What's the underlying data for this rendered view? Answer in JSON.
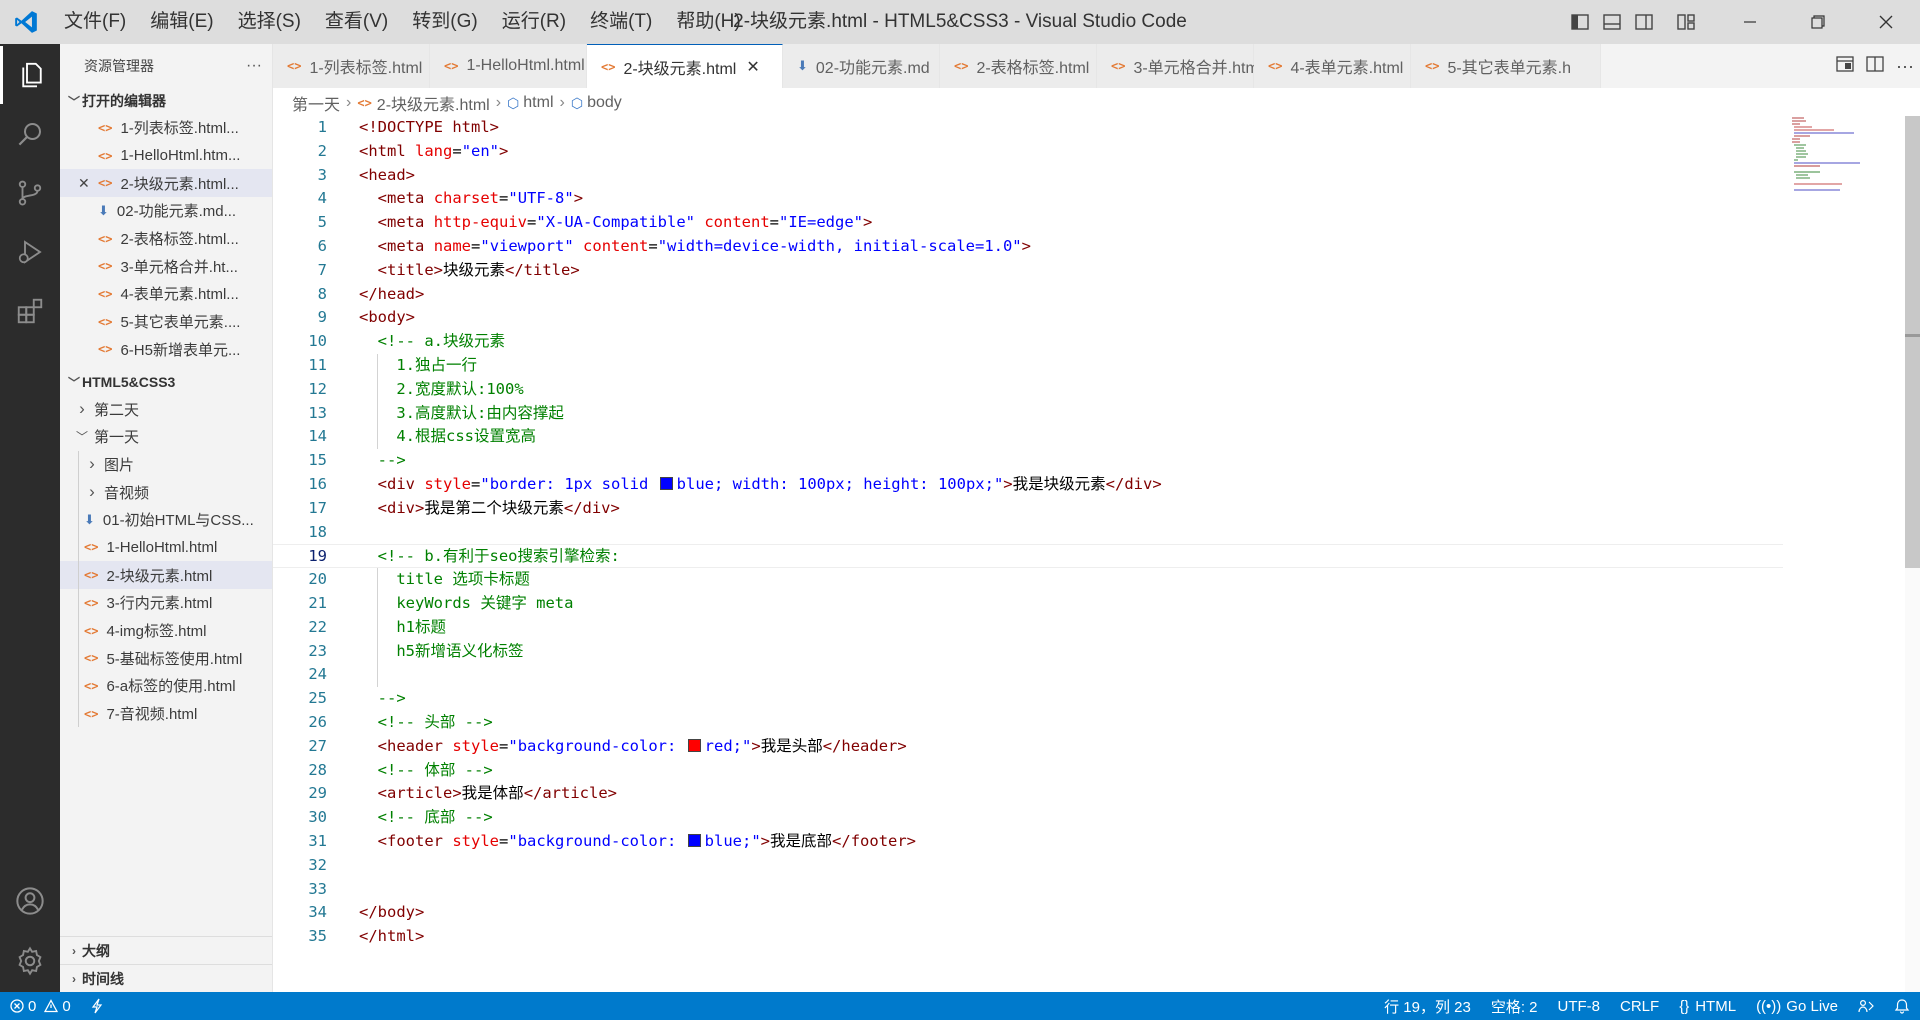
{
  "window": {
    "menu": [
      "文件(F)",
      "编辑(E)",
      "选择(S)",
      "查看(V)",
      "转到(G)",
      "运行(R)",
      "终端(T)",
      "帮助(H)"
    ],
    "title": "2-块级元素.html - HTML5&CSS3 - Visual Studio Code"
  },
  "sidebar": {
    "title": "资源管理器",
    "more": "···",
    "open_editors_label": "打开的编辑器",
    "open_editors": [
      {
        "label": "1-列表标签.html...",
        "icon": "html"
      },
      {
        "label": "1-HelloHtml.htm...",
        "icon": "html"
      },
      {
        "label": "2-块级元素.html...",
        "icon": "html",
        "close": "✕"
      },
      {
        "label": "02-功能元素.md...",
        "icon": "markdown"
      },
      {
        "label": "2-表格标签.html...",
        "icon": "html"
      },
      {
        "label": "3-单元格合并.ht...",
        "icon": "html"
      },
      {
        "label": "4-表单元素.html...",
        "icon": "html"
      },
      {
        "label": "5-其它表单元素....",
        "icon": "html"
      },
      {
        "label": "6-H5新增表单元...",
        "icon": "html"
      }
    ],
    "project_label": "HTML5&CSS3",
    "tree": [
      {
        "label": "第二天",
        "type": "folder-collapsed",
        "depth": 1
      },
      {
        "label": "第一天",
        "type": "folder-expanded",
        "depth": 1
      },
      {
        "label": "图片",
        "type": "folder-collapsed",
        "depth": 2
      },
      {
        "label": "音视频",
        "type": "folder-collapsed",
        "depth": 2
      },
      {
        "label": "01-初始HTML与CSS...",
        "type": "markdown",
        "depth": 2
      },
      {
        "label": "1-HelloHtml.html",
        "type": "html",
        "depth": 2
      },
      {
        "label": "2-块级元素.html",
        "type": "html",
        "depth": 2,
        "selected": true
      },
      {
        "label": "3-行内元素.html",
        "type": "html",
        "depth": 2
      },
      {
        "label": "4-img标签.html",
        "type": "html",
        "depth": 2
      },
      {
        "label": "5-基础标签使用.html",
        "type": "html",
        "depth": 2
      },
      {
        "label": "6-a标签的使用.html",
        "type": "html",
        "depth": 2
      },
      {
        "label": "7-音视频.html",
        "type": "html",
        "depth": 2
      }
    ],
    "outline_label": "大纲",
    "timeline_label": "时间线"
  },
  "tabs": [
    {
      "label": "1-列表标签.html",
      "icon": "html"
    },
    {
      "label": "1-HelloHtml.html",
      "icon": "html"
    },
    {
      "label": "2-块级元素.html",
      "icon": "html",
      "active": true,
      "close": "✕"
    },
    {
      "label": "02-功能元素.md",
      "icon": "markdown"
    },
    {
      "label": "2-表格标签.html",
      "icon": "html"
    },
    {
      "label": "3-单元格合并.html",
      "icon": "html"
    },
    {
      "label": "4-表单元素.html",
      "icon": "html"
    },
    {
      "label": "5-其它表单元素.h",
      "icon": "html"
    }
  ],
  "breadcrumb": [
    "第一天",
    "2-块级元素.html",
    "html",
    "body"
  ],
  "editor": {
    "current_line": 19,
    "lines": [
      [
        [
          "doc",
          "<!DOCTYPE "
        ],
        [
          "tag",
          "html"
        ],
        [
          "doc",
          ">"
        ]
      ],
      [
        [
          "tag",
          "<html"
        ],
        [
          "txt",
          " "
        ],
        [
          "attr",
          "lang"
        ],
        [
          "txt",
          "="
        ],
        [
          "str",
          "\"en\""
        ],
        [
          "tag",
          ">"
        ]
      ],
      [
        [
          "tag",
          "<head>"
        ]
      ],
      [
        [
          "txt",
          "  "
        ],
        [
          "tag",
          "<meta"
        ],
        [
          "txt",
          " "
        ],
        [
          "attr",
          "charset"
        ],
        [
          "txt",
          "="
        ],
        [
          "str",
          "\"UTF-8\""
        ],
        [
          "tag",
          ">"
        ]
      ],
      [
        [
          "txt",
          "  "
        ],
        [
          "tag",
          "<meta"
        ],
        [
          "txt",
          " "
        ],
        [
          "attr",
          "http-equiv"
        ],
        [
          "txt",
          "="
        ],
        [
          "str",
          "\"X-UA-Compatible\""
        ],
        [
          "txt",
          " "
        ],
        [
          "attr",
          "content"
        ],
        [
          "txt",
          "="
        ],
        [
          "str",
          "\"IE=edge\""
        ],
        [
          "tag",
          ">"
        ]
      ],
      [
        [
          "txt",
          "  "
        ],
        [
          "tag",
          "<meta"
        ],
        [
          "txt",
          " "
        ],
        [
          "attr",
          "name"
        ],
        [
          "txt",
          "="
        ],
        [
          "str",
          "\"viewport\""
        ],
        [
          "txt",
          " "
        ],
        [
          "attr",
          "content"
        ],
        [
          "txt",
          "="
        ],
        [
          "str",
          "\"width=device-width, initial-scale=1.0\""
        ],
        [
          "tag",
          ">"
        ]
      ],
      [
        [
          "txt",
          "  "
        ],
        [
          "tag",
          "<title>"
        ],
        [
          "txt",
          "块级元素"
        ],
        [
          "tag",
          "</title>"
        ]
      ],
      [
        [
          "tag",
          "</head>"
        ]
      ],
      [
        [
          "tag",
          "<body>"
        ]
      ],
      [
        [
          "txt",
          "  "
        ],
        [
          "com",
          "<!-- a.块级元素"
        ]
      ],
      [
        [
          "txt",
          "    "
        ],
        [
          "com",
          "1.独占一行"
        ]
      ],
      [
        [
          "txt",
          "    "
        ],
        [
          "com",
          "2.宽度默认:100%"
        ]
      ],
      [
        [
          "txt",
          "    "
        ],
        [
          "com",
          "3.高度默认:由内容撑起"
        ]
      ],
      [
        [
          "txt",
          "    "
        ],
        [
          "com",
          "4.根据css设置宽高"
        ]
      ],
      [
        [
          "txt",
          "  "
        ],
        [
          "com",
          "-->"
        ]
      ],
      [
        [
          "txt",
          "  "
        ],
        [
          "tag",
          "<div"
        ],
        [
          "txt",
          " "
        ],
        [
          "attr",
          "style"
        ],
        [
          "txt",
          "="
        ],
        [
          "str",
          "\"border: 1px solid "
        ],
        [
          "swatch",
          "#0000ff"
        ],
        [
          "str",
          "blue; width: 100px; height: 100px;\""
        ],
        [
          "tag",
          ">"
        ],
        [
          "txt",
          "我是块级元素"
        ],
        [
          "tag",
          "</div>"
        ]
      ],
      [
        [
          "txt",
          "  "
        ],
        [
          "tag",
          "<div>"
        ],
        [
          "txt",
          "我是第二个块级元素"
        ],
        [
          "tag",
          "</div>"
        ]
      ],
      [],
      [
        [
          "txt",
          "  "
        ],
        [
          "com",
          "<!-- b.有利于seo搜索引擎检索:"
        ]
      ],
      [
        [
          "txt",
          "    "
        ],
        [
          "com",
          "title 选项卡标题"
        ]
      ],
      [
        [
          "txt",
          "    "
        ],
        [
          "com",
          "keyWords 关键字 meta"
        ]
      ],
      [
        [
          "txt",
          "    "
        ],
        [
          "com",
          "h1标题"
        ]
      ],
      [
        [
          "txt",
          "    "
        ],
        [
          "com",
          "h5新增语义化标签"
        ]
      ],
      [],
      [
        [
          "txt",
          "  "
        ],
        [
          "com",
          "-->"
        ]
      ],
      [
        [
          "txt",
          "  "
        ],
        [
          "com",
          "<!-- 头部 -->"
        ]
      ],
      [
        [
          "txt",
          "  "
        ],
        [
          "tag",
          "<header"
        ],
        [
          "txt",
          " "
        ],
        [
          "attr",
          "style"
        ],
        [
          "txt",
          "="
        ],
        [
          "str",
          "\"background-color: "
        ],
        [
          "swatch",
          "#ff0000"
        ],
        [
          "str",
          "red;\""
        ],
        [
          "tag",
          ">"
        ],
        [
          "txt",
          "我是头部"
        ],
        [
          "tag",
          "</header>"
        ]
      ],
      [
        [
          "txt",
          "  "
        ],
        [
          "com",
          "<!-- 体部 -->"
        ]
      ],
      [
        [
          "txt",
          "  "
        ],
        [
          "tag",
          "<article>"
        ],
        [
          "txt",
          "我是体部"
        ],
        [
          "tag",
          "</article>"
        ]
      ],
      [
        [
          "txt",
          "  "
        ],
        [
          "com",
          "<!-- 底部 -->"
        ]
      ],
      [
        [
          "txt",
          "  "
        ],
        [
          "tag",
          "<footer"
        ],
        [
          "txt",
          " "
        ],
        [
          "attr",
          "style"
        ],
        [
          "txt",
          "="
        ],
        [
          "str",
          "\"background-color: "
        ],
        [
          "swatch",
          "#0000ff"
        ],
        [
          "str",
          "blue;\""
        ],
        [
          "tag",
          ">"
        ],
        [
          "txt",
          "我是底部"
        ],
        [
          "tag",
          "</footer>"
        ]
      ],
      [],
      [],
      [
        [
          "tag",
          "</body>"
        ]
      ],
      [
        [
          "tag",
          "</html>"
        ]
      ]
    ]
  },
  "status": {
    "errors": "0",
    "warnings": "0",
    "position": "行 19，列 23",
    "spaces": "空格: 2",
    "encoding": "UTF-8",
    "eol": "CRLF",
    "language": "HTML",
    "golive": "Go Live"
  },
  "colors": {
    "statusbar": "#007acc",
    "activitybar": "#2c2c2c",
    "tag": "#800000",
    "attr": "#e50000",
    "string": "#0000ff",
    "comment": "#008000",
    "html_icon": "#e37933"
  }
}
